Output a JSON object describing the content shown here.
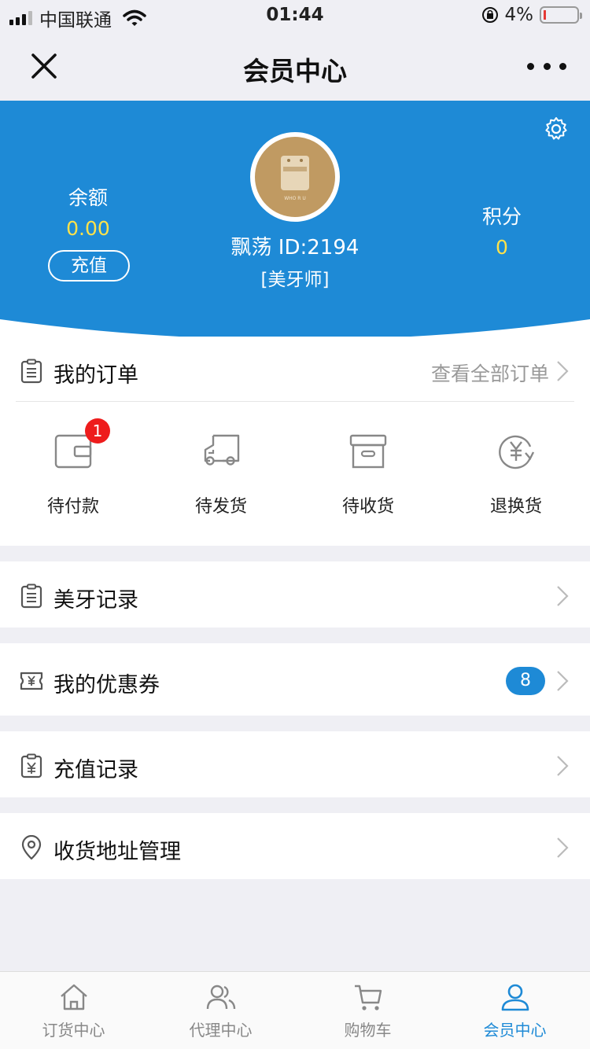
{
  "status_bar": {
    "carrier": "中国联通",
    "time": "01:44",
    "battery": "4%"
  },
  "nav": {
    "title": "会员中心"
  },
  "profile": {
    "balance_label": "余额",
    "balance_value": "0.00",
    "recharge_label": "充值",
    "name": "飘荡 ID:2194",
    "role": "[美牙师]",
    "points_label": "积分",
    "points_value": "0",
    "avatar_text": "WHO R U"
  },
  "orders": {
    "title": "我的订单",
    "view_all": "查看全部订单",
    "statuses": [
      {
        "label": "待付款",
        "icon": "wallet-icon",
        "badge": "1"
      },
      {
        "label": "待发货",
        "icon": "delivery-truck-icon"
      },
      {
        "label": "待收货",
        "icon": "box-icon"
      },
      {
        "label": "退换货",
        "icon": "yuan-refund-icon"
      }
    ]
  },
  "menu": [
    {
      "label": "美牙记录",
      "icon": "clipboard-icon"
    },
    {
      "label": "我的优惠券",
      "icon": "coupon-icon",
      "badge": "8"
    },
    {
      "label": "充值记录",
      "icon": "recharge-record-icon"
    },
    {
      "label": "收货地址管理",
      "icon": "location-pin-icon"
    }
  ],
  "tabs": [
    {
      "label": "订货中心",
      "icon": "home-icon",
      "active": false
    },
    {
      "label": "代理中心",
      "icon": "users-icon",
      "active": false
    },
    {
      "label": "购物车",
      "icon": "cart-icon",
      "active": false
    },
    {
      "label": "会员中心",
      "icon": "user-icon",
      "active": true
    }
  ],
  "colors": {
    "brand_blue": "#1e8ad6",
    "money_yellow": "#ffe24a",
    "badge_red": "#ee1c1c"
  }
}
